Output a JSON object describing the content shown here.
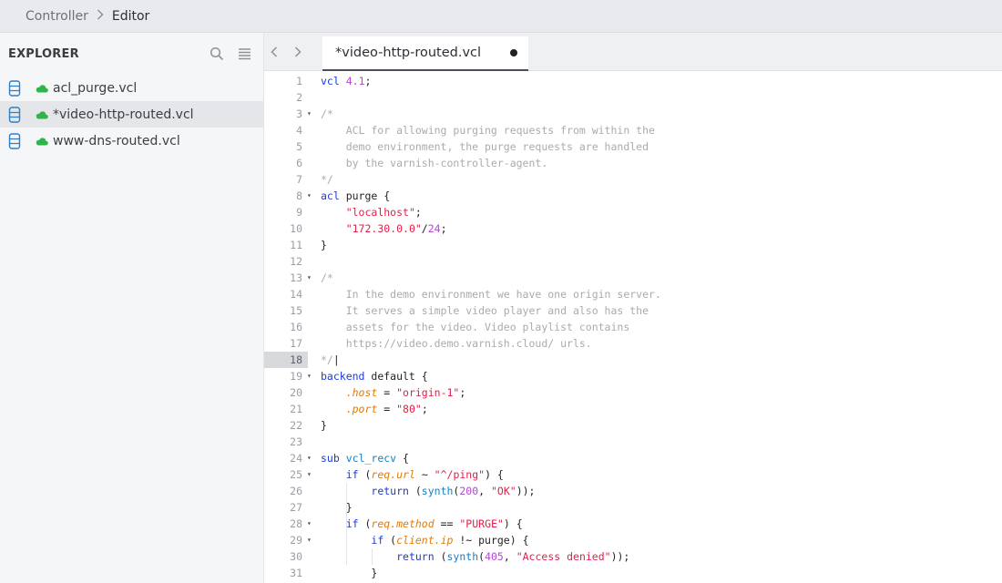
{
  "breadcrumb": {
    "items": [
      "Controller",
      "Editor"
    ]
  },
  "explorer": {
    "title": "EXPLORER",
    "files": [
      {
        "name": "acl_purge.vcl"
      },
      {
        "name": "*video-http-routed.vcl"
      },
      {
        "name": "www-dns-routed.vcl"
      }
    ]
  },
  "tab": {
    "label": "*video-http-routed.vcl"
  },
  "icons": {
    "search": "search-icon",
    "list": "list-icon",
    "prev": "chevron-left-icon",
    "next": "chevron-right-icon",
    "file": "database-file-icon",
    "cloud": "cloud-icon",
    "unsaved": "unsaved-dot-icon"
  },
  "colors": {
    "cloud": "#2fb44a",
    "file_icon": "#2d7fc4",
    "keyword": "#1b3bd6",
    "string": "#e0214a",
    "comment": "#a8abb0"
  },
  "code": [
    {
      "n": "1",
      "fold": false,
      "tokens": [
        [
          "kw",
          "vcl"
        ],
        [
          "pl",
          " "
        ],
        [
          "num",
          "4.1"
        ],
        [
          "pl",
          ";"
        ]
      ]
    },
    {
      "n": "2",
      "fold": false,
      "tokens": []
    },
    {
      "n": "3",
      "fold": true,
      "tokens": [
        [
          "cmt",
          "/*"
        ]
      ]
    },
    {
      "n": "4",
      "fold": false,
      "tokens": [
        [
          "cmt",
          "    ACL for allowing purging requests from within the"
        ]
      ]
    },
    {
      "n": "5",
      "fold": false,
      "tokens": [
        [
          "cmt",
          "    demo environment, the purge requests are handled"
        ]
      ]
    },
    {
      "n": "6",
      "fold": false,
      "tokens": [
        [
          "cmt",
          "    by the varnish-controller-agent."
        ]
      ]
    },
    {
      "n": "7",
      "fold": false,
      "tokens": [
        [
          "cmt",
          "*/"
        ]
      ]
    },
    {
      "n": "8",
      "fold": true,
      "tokens": [
        [
          "kw",
          "acl"
        ],
        [
          "pl",
          " purge {"
        ]
      ]
    },
    {
      "n": "9",
      "fold": false,
      "tokens": [
        [
          "pl",
          "    "
        ],
        [
          "str",
          "\"localhost\""
        ],
        [
          "pl",
          ";"
        ]
      ]
    },
    {
      "n": "10",
      "fold": false,
      "tokens": [
        [
          "pl",
          "    "
        ],
        [
          "str",
          "\"172.30.0.0\""
        ],
        [
          "pl",
          "/"
        ],
        [
          "num",
          "24"
        ],
        [
          "pl",
          ";"
        ]
      ]
    },
    {
      "n": "11",
      "fold": false,
      "tokens": [
        [
          "pl",
          "}"
        ]
      ]
    },
    {
      "n": "12",
      "fold": false,
      "tokens": []
    },
    {
      "n": "13",
      "fold": true,
      "tokens": [
        [
          "cmt",
          "/*"
        ]
      ]
    },
    {
      "n": "14",
      "fold": false,
      "tokens": [
        [
          "cmt",
          "    In the demo environment we have one origin server."
        ]
      ]
    },
    {
      "n": "15",
      "fold": false,
      "tokens": [
        [
          "cmt",
          "    It serves a simple video player and also has the"
        ]
      ]
    },
    {
      "n": "16",
      "fold": false,
      "tokens": [
        [
          "cmt",
          "    assets for the video. Video playlist contains"
        ]
      ]
    },
    {
      "n": "17",
      "fold": false,
      "tokens": [
        [
          "cmt",
          "    https://video.demo.varnish.cloud/ urls."
        ]
      ]
    },
    {
      "n": "18",
      "fold": false,
      "hl": true,
      "tokens": [
        [
          "cmt",
          "*/"
        ],
        [
          "pl",
          "|"
        ]
      ]
    },
    {
      "n": "19",
      "fold": true,
      "tokens": [
        [
          "kw",
          "backend"
        ],
        [
          "pl",
          " default {"
        ]
      ]
    },
    {
      "n": "20",
      "fold": false,
      "tokens": [
        [
          "pl",
          "    "
        ],
        [
          "var",
          ".host"
        ],
        [
          "pl",
          " = "
        ],
        [
          "str",
          "\"origin-1\""
        ],
        [
          "pl",
          ";"
        ]
      ]
    },
    {
      "n": "21",
      "fold": false,
      "tokens": [
        [
          "pl",
          "    "
        ],
        [
          "var",
          ".port"
        ],
        [
          "pl",
          " = "
        ],
        [
          "str",
          "\"80\""
        ],
        [
          "pl",
          ";"
        ]
      ]
    },
    {
      "n": "22",
      "fold": false,
      "tokens": [
        [
          "pl",
          "}"
        ]
      ]
    },
    {
      "n": "23",
      "fold": false,
      "tokens": []
    },
    {
      "n": "24",
      "fold": true,
      "tokens": [
        [
          "kw",
          "sub"
        ],
        [
          "pl",
          " "
        ],
        [
          "fn",
          "vcl_recv"
        ],
        [
          "pl",
          " {"
        ]
      ]
    },
    {
      "n": "25",
      "fold": true,
      "tokens": [
        [
          "pl",
          "    "
        ],
        [
          "kw",
          "if"
        ],
        [
          "pl",
          " ("
        ],
        [
          "var",
          "req.url"
        ],
        [
          "pl",
          " ~ "
        ],
        [
          "str",
          "\"^/ping\""
        ],
        [
          "pl",
          ") {"
        ]
      ]
    },
    {
      "n": "26",
      "fold": false,
      "tokens": [
        [
          "pl",
          "        "
        ],
        [
          "kw",
          "return"
        ],
        [
          "pl",
          " ("
        ],
        [
          "fn",
          "synth"
        ],
        [
          "pl",
          "("
        ],
        [
          "num",
          "200"
        ],
        [
          "pl",
          ", "
        ],
        [
          "str",
          "\"OK\""
        ],
        [
          "pl",
          "));"
        ]
      ]
    },
    {
      "n": "27",
      "fold": false,
      "tokens": [
        [
          "pl",
          "    }"
        ]
      ]
    },
    {
      "n": "28",
      "fold": true,
      "tokens": [
        [
          "pl",
          "    "
        ],
        [
          "kw",
          "if"
        ],
        [
          "pl",
          " ("
        ],
        [
          "var",
          "req.method"
        ],
        [
          "pl",
          " == "
        ],
        [
          "str",
          "\"PURGE\""
        ],
        [
          "pl",
          ") {"
        ]
      ]
    },
    {
      "n": "29",
      "fold": true,
      "tokens": [
        [
          "pl",
          "        "
        ],
        [
          "kw",
          "if"
        ],
        [
          "pl",
          " ("
        ],
        [
          "var",
          "client.ip"
        ],
        [
          "pl",
          " !~ purge) {"
        ]
      ]
    },
    {
      "n": "30",
      "fold": false,
      "tokens": [
        [
          "pl",
          "            "
        ],
        [
          "kw",
          "return"
        ],
        [
          "pl",
          " ("
        ],
        [
          "fn",
          "synth"
        ],
        [
          "pl",
          "("
        ],
        [
          "num",
          "405"
        ],
        [
          "pl",
          ", "
        ],
        [
          "str",
          "\"Access denied\""
        ],
        [
          "pl",
          "));"
        ]
      ]
    },
    {
      "n": "31",
      "fold": false,
      "tokens": [
        [
          "pl",
          "        }"
        ]
      ]
    }
  ]
}
